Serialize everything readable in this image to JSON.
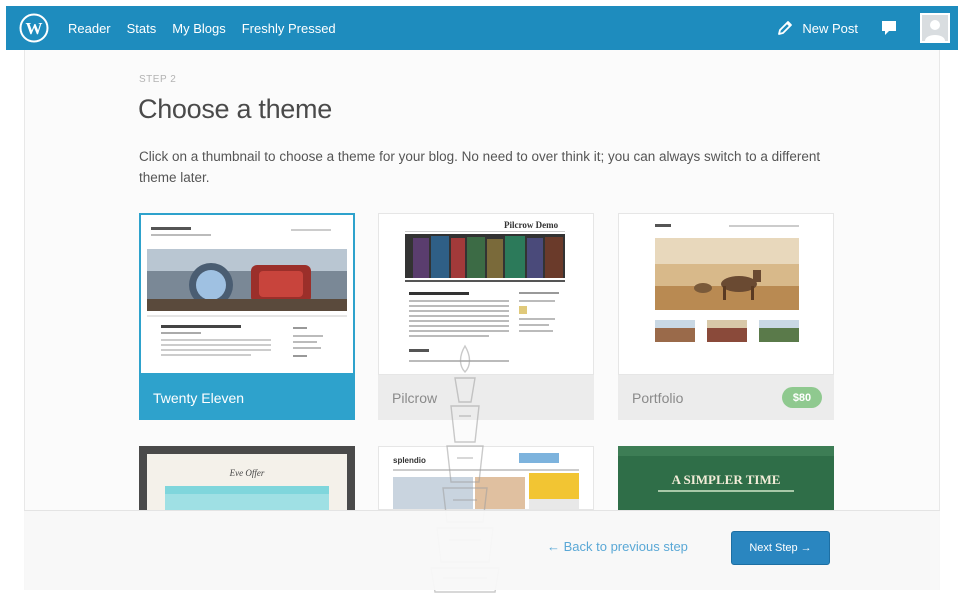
{
  "topbar": {
    "nav": [
      "Reader",
      "Stats",
      "My Blogs",
      "Freshly Pressed"
    ],
    "new_post": "New Post",
    "colors": {
      "bar": "#1e8cbe"
    },
    "icons": [
      "wordpress-logo-icon",
      "pencil-icon",
      "notification-bubble-icon",
      "avatar"
    ]
  },
  "main": {
    "step": "STEP 2",
    "title": "Choose a theme",
    "intro": "Click on a thumbnail to choose a theme for your blog. No need to over think it; you can always switch to a different theme later."
  },
  "themes": [
    {
      "name": "Twenty Eleven",
      "selected": true
    },
    {
      "name": "Pilcrow",
      "thumb_title": "Pilcrow Demo"
    },
    {
      "name": "Portfolio",
      "price": "$80"
    },
    {
      "thumb_title": "Eve Offer"
    },
    {
      "thumb_title": "splendio"
    },
    {
      "thumb_title": "A SIMPLER TIME"
    }
  ],
  "footer": {
    "back": "← Back to previous step",
    "next": "Next Step →"
  },
  "accent": "#2ea2cc"
}
